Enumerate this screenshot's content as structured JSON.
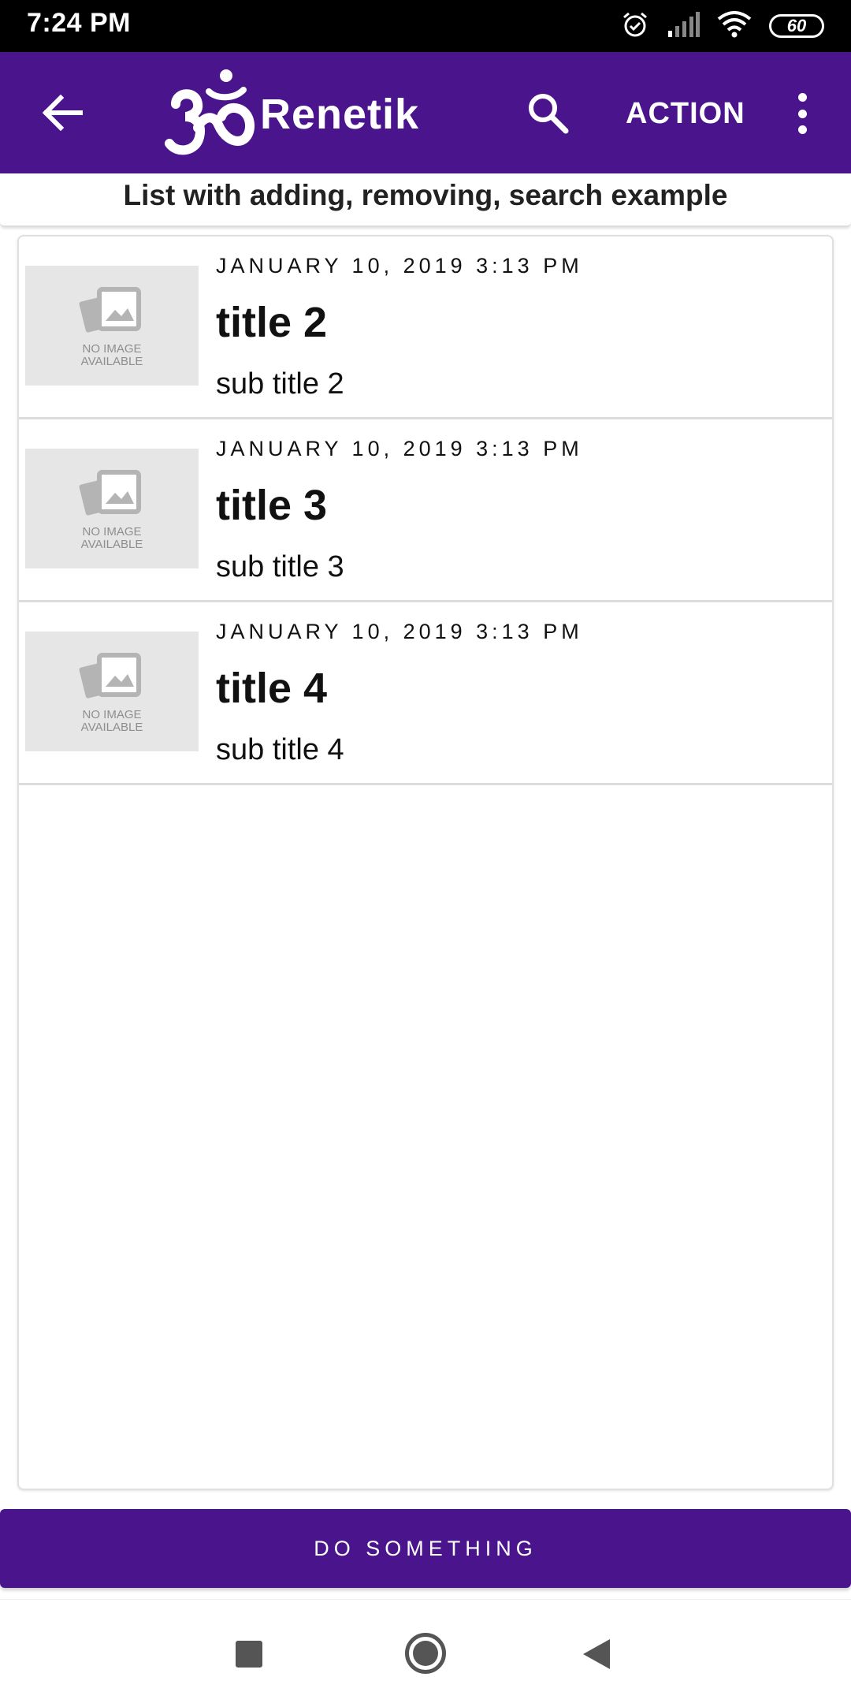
{
  "status_bar": {
    "time": "7:24 PM",
    "battery": "60",
    "icons": [
      "alarm-icon",
      "signal-icon",
      "wifi-icon",
      "battery-icon"
    ]
  },
  "app_bar": {
    "title": "Renetik",
    "action_label": "ACTION",
    "color": "#4a148c",
    "icons": [
      "back-arrow-icon",
      "om-logo-icon",
      "search-icon",
      "more-vert-icon"
    ]
  },
  "subtitle": "List with adding, removing, search example",
  "list": {
    "items": [
      {
        "date": "JANUARY 10, 2019 3:13 PM",
        "title": "title 2",
        "subtitle": "sub title 2",
        "image_text": "NO IMAGE AVAILABLE"
      },
      {
        "date": "JANUARY 10, 2019 3:13 PM",
        "title": "title 3",
        "subtitle": "sub title 3",
        "image_text": "NO IMAGE AVAILABLE"
      },
      {
        "date": "JANUARY 10, 2019 3:13 PM",
        "title": "title 4",
        "subtitle": "sub title 4",
        "image_text": "NO IMAGE AVAILABLE"
      }
    ]
  },
  "bottom_button": {
    "label": "DO SOMETHING"
  },
  "nav_bar": {
    "icons": [
      "recent-apps-icon",
      "home-icon",
      "back-triangle-icon"
    ]
  }
}
